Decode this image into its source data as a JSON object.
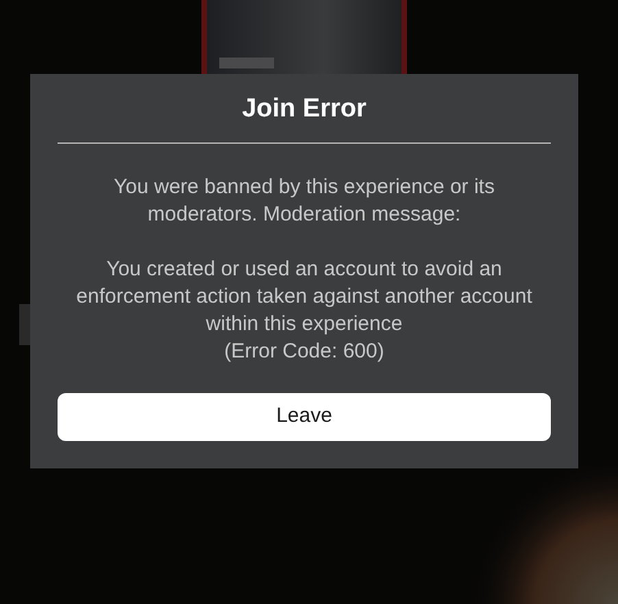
{
  "dialog": {
    "title": "Join Error",
    "message": [
      "You were banned by this experience or its moderators. Moderation message:",
      "You created or used an account to avoid an enforcement action taken against another account within this experience"
    ],
    "error_code": "(Error Code: 600)",
    "buttons": [
      "Leave"
    ]
  }
}
